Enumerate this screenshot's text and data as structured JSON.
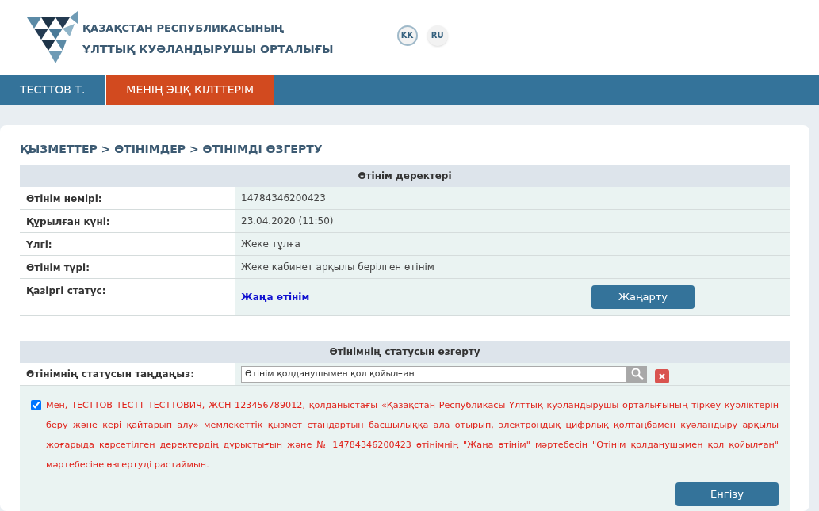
{
  "header": {
    "logo_line_1": "ҚАЗАҚСТАН РЕСПУБЛИКАСЫНЫҢ",
    "logo_line_2": "ҰЛТТЫҚ КУӘЛАНДЫРУШЫ ОРТАЛЫҒЫ",
    "languages": [
      {
        "label": "KK",
        "selected": true
      },
      {
        "label": "RU",
        "selected": false
      }
    ]
  },
  "nav": [
    {
      "label": "ТЕСТТОВ Т.",
      "selected": false
    },
    {
      "label": "МЕНІҢ ЭЦҚ КІЛТТЕРІМ",
      "selected": true
    }
  ],
  "breadcrumb": "ҚЫЗМЕТТЕР > ӨТІНІМДЕР > ӨТІНІМДІ ӨЗГЕРТУ",
  "details": {
    "title": "Өтінім деректері",
    "rows": [
      {
        "label": "Өтінім нөмірі:",
        "value": "14784346200423"
      },
      {
        "label": "Құрылған күні:",
        "value": "23.04.2020 (11:50)"
      },
      {
        "label": "Үлгі:",
        "value": "Жеке тұлға"
      },
      {
        "label": "Өтінім түрі:",
        "value": "Жеке кабинет арқылы берілген өтінім"
      }
    ],
    "status": {
      "label": "Қазіргі статус:",
      "value": "Жаңа өтінім",
      "button": "Жаңарту"
    }
  },
  "change": {
    "title": "Өтінімнің статусын өзгерту",
    "label": "Өтінімнің статусын таңдаңыз:",
    "value": "Өтінім қолданушымен қол қойылған",
    "agreement": {
      "checked": true,
      "text": "Мен, ТЕСТТОВ ТЕСТТ ТЕСТТОВИЧ, ЖСН 123456789012, қолданыстағы «Қазақстан Республикасы Ұлттық куәландырушы орталығының тіркеу куәліктерін беру және кері қайтарып алу» мемлекеттік қызмет стандартын басшылыққа ала отырып, электрондық цифрлық қолтаңбамен куәландыру арқылы жоғарыда көрсетілген деректердің дұрыстығын және № 14784346200423 өтінімнің \"Жаңа өтінім\" мәртебесін \"Өтінім қолданушымен қол қойылған\" мәртебесіне өзгертуді растаймын."
    },
    "submit": "Енгізу"
  }
}
